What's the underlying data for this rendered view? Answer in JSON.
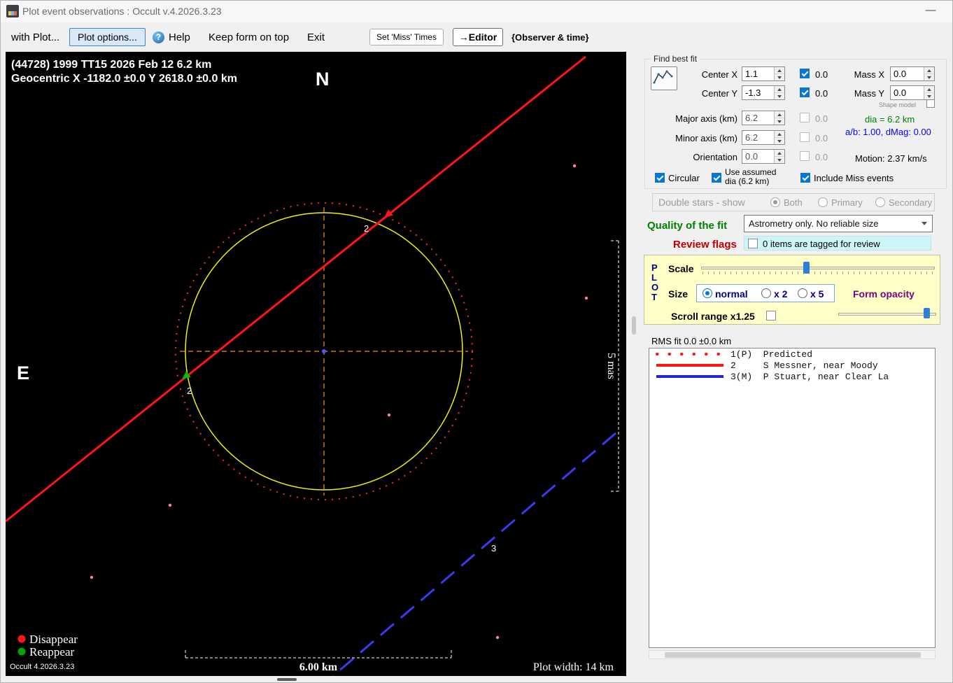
{
  "window": {
    "title": "Plot event observations : Occult v.4.2026.3.23",
    "minimize_glyph": "—"
  },
  "toolbar": {
    "with_plot": "with Plot...",
    "plot_options": "Plot options...",
    "help": "Help",
    "keep_form_on_top": "Keep form on top",
    "exit": "Exit",
    "set_miss_times": "Set 'Miss' Times",
    "editor": "→Editor",
    "observer_time": "{Observer & time}"
  },
  "plot": {
    "title_line1": "(44728) 1999 TT15  2026 Feb 12   6.2 km",
    "title_line2": "Geocentric X  -1182.0 ±0.0 Y 2618.0 ±0.0 km",
    "north": "N",
    "east": "E",
    "chord2_label": "2",
    "chord3_label": "3",
    "v_scale": "5 mas",
    "h_scale": "6.00 km",
    "legend": {
      "disappear": "Disappear",
      "reappear": "Reappear"
    },
    "version": "Occult 4.2026.3.23",
    "plot_width": "Plot width: 14 km"
  },
  "find_best_fit": {
    "title": "Find best fit",
    "center_x_label": "Center X",
    "center_x_value": "1.1",
    "center_x_fit": "0.0",
    "mass_x_label": "Mass X",
    "mass_x_value": "0.0",
    "center_y_label": "Center Y",
    "center_y_value": "-1.3",
    "center_y_fit": "0.0",
    "mass_y_label": "Mass Y",
    "mass_y_value": "0.0",
    "shape_model_label": "Shape model",
    "major_axis_label": "Major axis (km)",
    "major_axis_value": "6.2",
    "major_axis_fit": "0.0",
    "dia_text": "dia = 6.2 km",
    "ab_text": "a/b: 1.00, dMag: 0.00",
    "minor_axis_label": "Minor axis (km)",
    "minor_axis_value": "6.2",
    "minor_axis_fit": "0.0",
    "orientation_label": "Orientation",
    "orientation_value": "0.0",
    "orientation_fit": "0.0",
    "motion_text": "Motion: 2.37 km/s",
    "circular_label": "Circular",
    "use_assumed_label": "Use assumed dia (6.2 km)",
    "include_miss_label": "Include Miss events"
  },
  "double_stars": {
    "title": "Double stars - show",
    "both": "Both",
    "primary": "Primary",
    "secondary": "Secondary"
  },
  "quality": {
    "label": "Quality of the fit",
    "value": "Astrometry only. No reliable size"
  },
  "review": {
    "label": "Review flags",
    "text": "0 items are tagged for review"
  },
  "plot_controls": {
    "letters": [
      "P",
      "L",
      "O",
      "T"
    ],
    "scale_label": "Scale",
    "size_label": "Size",
    "size_normal": "normal",
    "size_x2": "x 2",
    "size_x5": "x 5",
    "form_opacity": "Form opacity",
    "scroll_range": "Scroll range x1.25"
  },
  "rms": {
    "text": "RMS fit  0.0 ±0.0 km"
  },
  "observations": {
    "rows": [
      {
        "text": "1(P)  Predicted",
        "style": "red-dotted"
      },
      {
        "text": "2     S Messner, near Moody",
        "style": "red-solid"
      },
      {
        "text": "3(M)  P Stuart, near Clear La",
        "style": "blue-solid"
      }
    ]
  },
  "colors": {
    "accent": "#0b76d1",
    "plot_red": "#ff1515",
    "plot_blue": "#3a3af0",
    "plot_yellow": "#f0f014",
    "plot_orange": "#c87d00",
    "reappear_green": "#00a500",
    "star_pink": "#ff7ab8",
    "quality_green": "#008000",
    "review_red": "#c00000",
    "opacity_purple": "#800080",
    "navy": "#000080"
  }
}
